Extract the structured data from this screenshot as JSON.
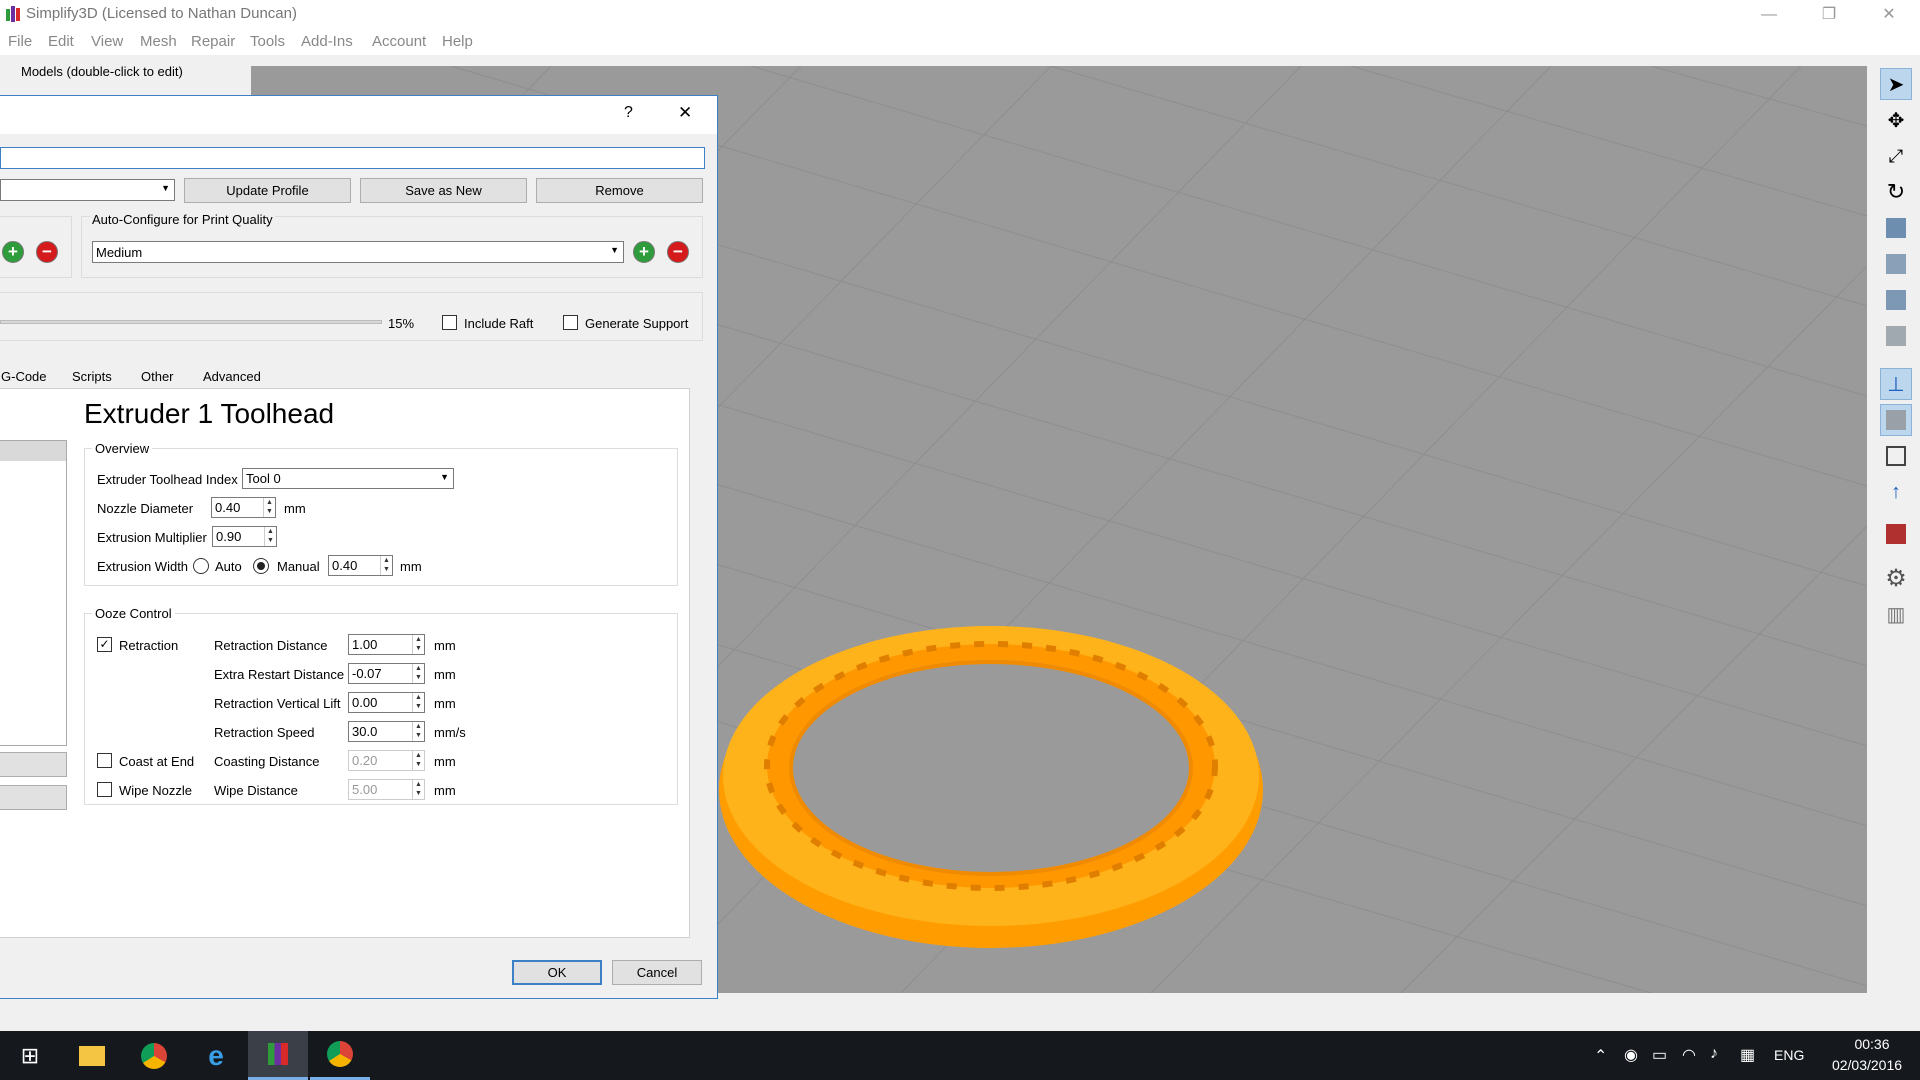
{
  "window": {
    "title": "Simplify3D (Licensed to Nathan Duncan)"
  },
  "menu": [
    "File",
    "Edit",
    "View",
    "Mesh",
    "Repair",
    "Tools",
    "Add-Ins",
    "Account",
    "Help"
  ],
  "models_panel": {
    "label": "Models (double-click to edit)"
  },
  "dialog": {
    "help": "?",
    "close": "✕",
    "profile_buttons": {
      "update": "Update Profile",
      "save_new": "Save as New",
      "remove": "Remove"
    },
    "auto_configure": {
      "label": "Auto-Configure for Print Quality",
      "value": "Medium"
    },
    "infill_percent": "15%",
    "include_raft": "Include Raft",
    "generate_support": "Generate Support",
    "tabs": [
      "G-Code",
      "Scripts",
      "Other",
      "Advanced"
    ],
    "section_title": "Extruder 1 Toolhead",
    "overview": {
      "legend": "Overview",
      "toolhead_index_label": "Extruder Toolhead Index",
      "toolhead_index_value": "Tool 0",
      "nozzle_label": "Nozzle Diameter",
      "nozzle_value": "0.40",
      "nozzle_unit": "mm",
      "multiplier_label": "Extrusion Multiplier",
      "multiplier_value": "0.90",
      "width_label": "Extrusion Width",
      "auto": "Auto",
      "manual": "Manual",
      "width_value": "0.40",
      "width_unit": "mm"
    },
    "ooze": {
      "legend": "Ooze Control",
      "retraction": "Retraction",
      "retraction_checked": true,
      "coast": "Coast at End",
      "wipe": "Wipe Nozzle",
      "rows": [
        {
          "label": "Retraction Distance",
          "value": "1.00",
          "unit": "mm"
        },
        {
          "label": "Extra Restart Distance",
          "value": "-0.07",
          "unit": "mm"
        },
        {
          "label": "Retraction Vertical Lift",
          "value": "0.00",
          "unit": "mm"
        },
        {
          "label": "Retraction Speed",
          "value": "30.0",
          "unit": "mm/s"
        },
        {
          "label": "Coasting Distance",
          "value": "0.20",
          "unit": "mm"
        },
        {
          "label": "Wipe Distance",
          "value": "5.00",
          "unit": "mm"
        }
      ]
    },
    "ok": "OK",
    "cancel": "Cancel"
  },
  "tray": {
    "time": "00:36",
    "date": "02/03/2016",
    "lang": "ENG"
  },
  "colors": {
    "accent": "#3c80c8",
    "model_orange": "#ffa200",
    "viewport_grey": "#9a9a9a"
  }
}
